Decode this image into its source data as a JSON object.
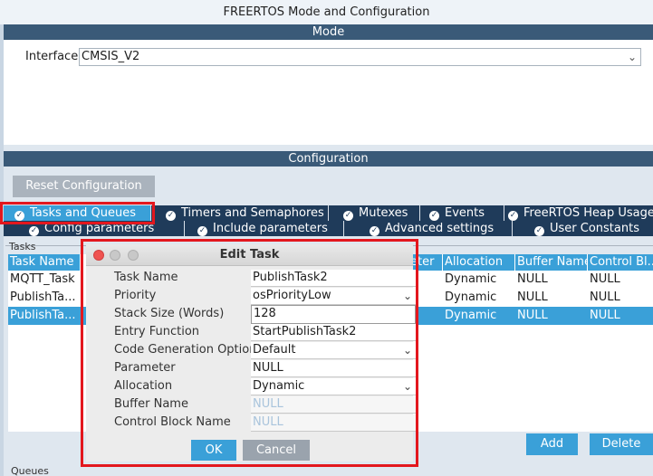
{
  "window": {
    "title": "FREERTOS Mode and Configuration"
  },
  "mode": {
    "header": "Mode",
    "interface_label": "Interface",
    "interface_value": "CMSIS_V2"
  },
  "configuration": {
    "header": "Configuration",
    "reset_label": "Reset Configuration"
  },
  "tabs_row1": [
    {
      "label": "Tasks and Queues"
    },
    {
      "label": "Timers and Semaphores"
    },
    {
      "label": "Mutexes"
    },
    {
      "label": "Events"
    },
    {
      "label": "FreeRTOS Heap Usage"
    }
  ],
  "tabs_row2": [
    {
      "label": "Config parameters"
    },
    {
      "label": "Include parameters"
    },
    {
      "label": "Advanced settings"
    },
    {
      "label": "User Constants"
    }
  ],
  "tasks": {
    "legend": "Tasks",
    "headers": {
      "task_name": "Task Name",
      "parameter_partial": "eter",
      "allocation": "Allocation",
      "buffer_name": "Buffer Name",
      "control_block": "Control Bl..."
    },
    "rows": [
      {
        "name": "MQTT_Task",
        "allocation": "Dynamic",
        "buffer": "NULL",
        "control": "NULL"
      },
      {
        "name": "PublishTa...",
        "allocation": "Dynamic",
        "buffer": "NULL",
        "control": "NULL"
      },
      {
        "name": "PublishTa...",
        "allocation": "Dynamic",
        "buffer": "NULL",
        "control": "NULL"
      }
    ],
    "add_label": "Add",
    "delete_label": "Delete"
  },
  "queues": {
    "legend": "Queues"
  },
  "dialog": {
    "title": "Edit Task",
    "fields": {
      "task_name": {
        "label": "Task Name",
        "value": "PublishTask2"
      },
      "priority": {
        "label": "Priority",
        "value": "osPriorityLow"
      },
      "stack_size": {
        "label": "Stack Size (Words)",
        "value": "128"
      },
      "entry_function": {
        "label": "Entry Function",
        "value": "StartPublishTask2"
      },
      "code_generation": {
        "label": "Code Generation Option",
        "value": "Default"
      },
      "parameter": {
        "label": "Parameter",
        "value": "NULL"
      },
      "allocation": {
        "label": "Allocation",
        "value": "Dynamic"
      },
      "buffer_name": {
        "label": "Buffer Name",
        "value": "NULL"
      },
      "control_block_name": {
        "label": "Control Block Name",
        "value": "NULL"
      }
    },
    "ok_label": "OK",
    "cancel_label": "Cancel"
  },
  "colors": {
    "accent": "#3aa0d8",
    "tab_bg": "#1f3b5a",
    "header_band": "#3a5a78",
    "highlight": "#e3171e"
  }
}
